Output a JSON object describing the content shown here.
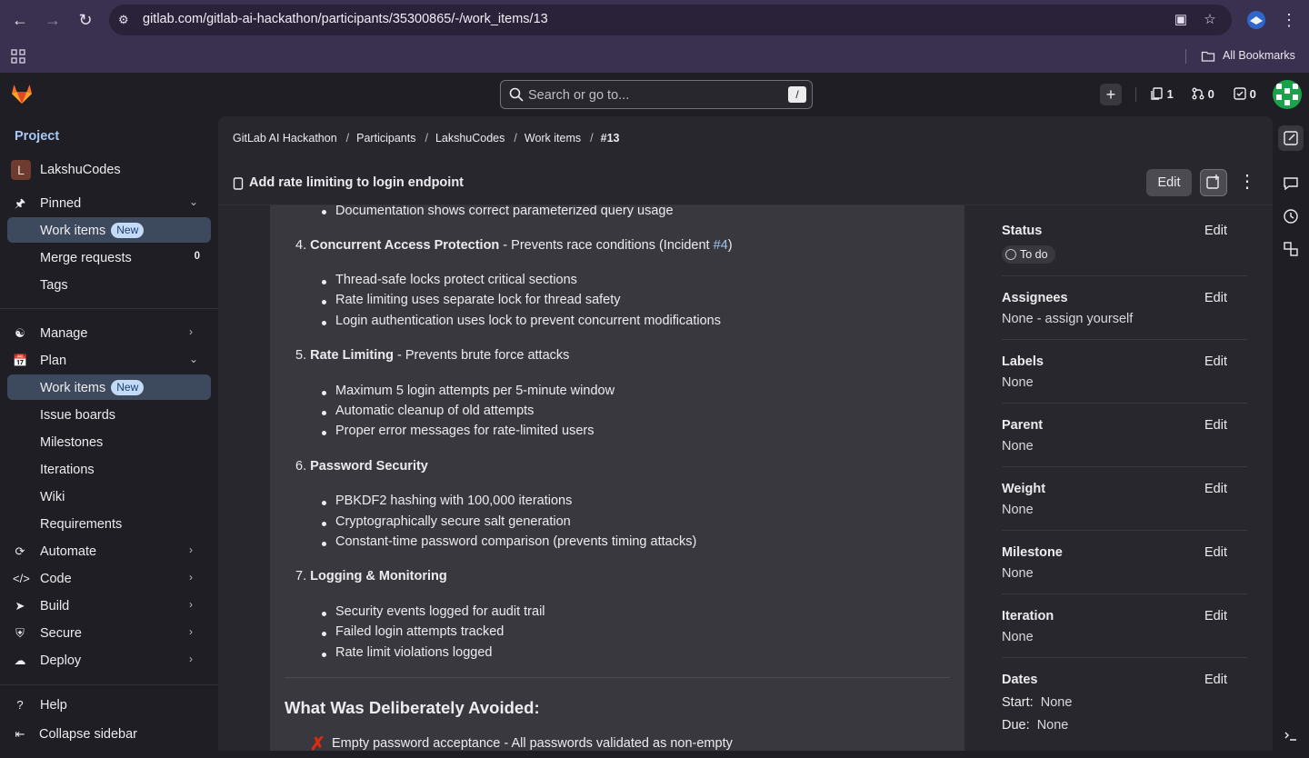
{
  "browser": {
    "url": "gitlab.com/gitlab-ai-hackathon/participants/35300865/-/work_items/13",
    "bookmarks_label": "All Bookmarks"
  },
  "topbar": {
    "search_placeholder": "Search or go to...",
    "search_shortcut": "/",
    "issues_count": "1",
    "merge_requests_count": "0",
    "todos_count": "0"
  },
  "sidebar": {
    "heading": "Project",
    "project_initial": "L",
    "project_name": "LakshuCodes",
    "pinned": "Pinned",
    "pinned_items": [
      {
        "label": "Work items",
        "badge": "New"
      },
      {
        "label": "Merge requests",
        "count": "0"
      },
      {
        "label": "Tags"
      }
    ],
    "manage": "Manage",
    "plan": "Plan",
    "plan_items": [
      {
        "label": "Work items",
        "badge": "New"
      },
      {
        "label": "Issue boards"
      },
      {
        "label": "Milestones"
      },
      {
        "label": "Iterations"
      },
      {
        "label": "Wiki"
      },
      {
        "label": "Requirements"
      }
    ],
    "groups": [
      "Automate",
      "Code",
      "Build",
      "Secure",
      "Deploy"
    ],
    "help": "Help",
    "collapse": "Collapse sidebar"
  },
  "breadcrumbs": [
    "GitLab AI Hackathon",
    "Participants",
    "LakshuCodes",
    "Work items",
    "#13"
  ],
  "work_item": {
    "title": "Add rate limiting to login endpoint",
    "edit_label": "Edit"
  },
  "description": {
    "top_bullet": "Documentation shows correct parameterized query usage",
    "sections": [
      {
        "num": "4.",
        "title": "Concurrent Access Protection",
        "rest": " - Prevents race conditions (Incident ",
        "link": "#4",
        "tail": ")",
        "bullets": [
          "Thread-safe locks protect critical sections",
          "Rate limiting uses separate lock for thread safety",
          "Login authentication uses lock to prevent concurrent modifications"
        ]
      },
      {
        "num": "5.",
        "title": "Rate Limiting",
        "rest": " - Prevents brute force attacks",
        "link": "",
        "tail": "",
        "bullets": [
          "Maximum 5 login attempts per 5-minute window",
          "Automatic cleanup of old attempts",
          "Proper error messages for rate-limited users"
        ]
      },
      {
        "num": "6.",
        "title": "Password Security",
        "rest": "",
        "link": "",
        "tail": "",
        "bullets": [
          "PBKDF2 hashing with 100,000 iterations",
          "Cryptographically secure salt generation",
          "Constant-time password comparison (prevents timing attacks)"
        ]
      },
      {
        "num": "7.",
        "title": "Logging & Monitoring",
        "rest": "",
        "link": "",
        "tail": "",
        "bullets": [
          "Security events logged for audit trail",
          "Failed login attempts tracked",
          "Rate limit violations logged"
        ]
      }
    ],
    "heading_avoided": "What Was Deliberately Avoided:",
    "cut_line": "Empty password acceptance - All passwords validated as non-empty"
  },
  "attributes": {
    "edit": "Edit",
    "status": {
      "label": "Status",
      "value": "To do"
    },
    "assignees": {
      "label": "Assignees",
      "value": "None - assign yourself"
    },
    "labels": {
      "label": "Labels",
      "value": "None"
    },
    "parent": {
      "label": "Parent",
      "value": "None"
    },
    "weight": {
      "label": "Weight",
      "value": "None"
    },
    "milestone": {
      "label": "Milestone",
      "value": "None"
    },
    "iteration": {
      "label": "Iteration",
      "value": "None"
    },
    "dates": {
      "label": "Dates",
      "start_label": "Start:",
      "start": "None",
      "due_label": "Due:",
      "due": "None"
    }
  },
  "colors": {
    "accent": "#a9c8f3",
    "link": "#9dc7f1",
    "active_nav": "#3d4a5e",
    "chrome": "#3a3150"
  }
}
